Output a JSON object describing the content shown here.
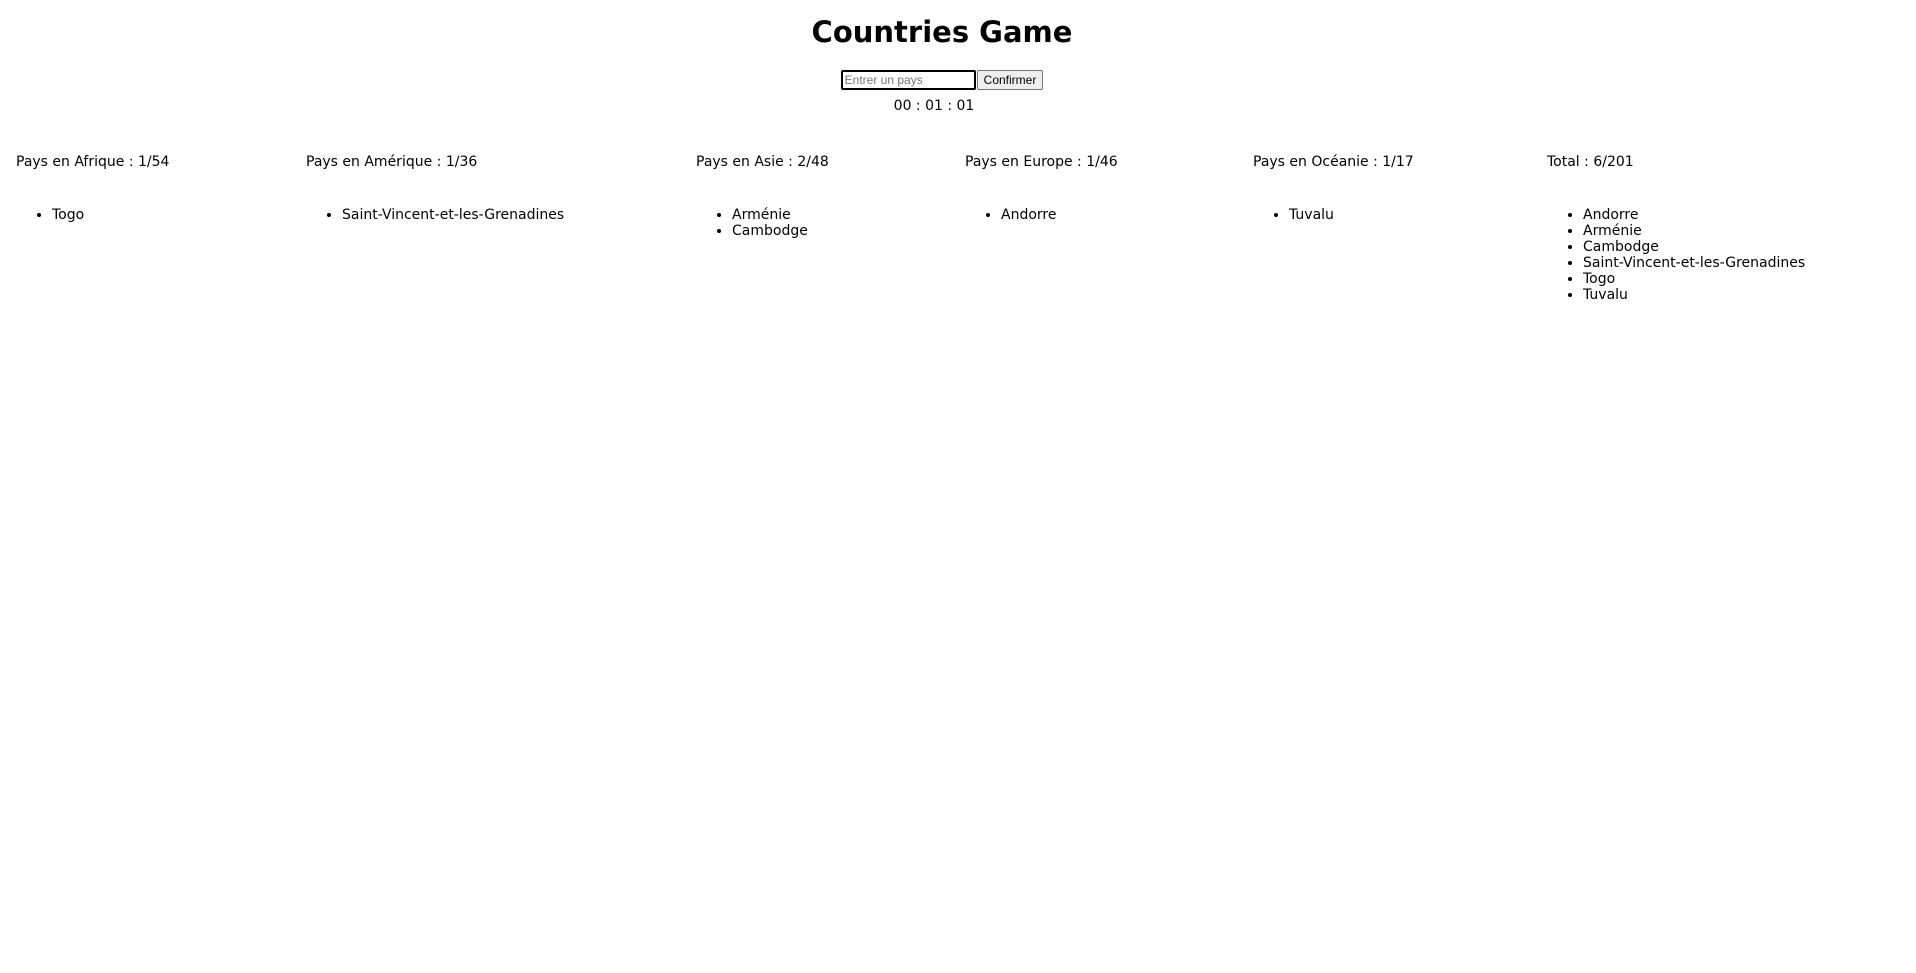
{
  "header": {
    "title": "Countries Game"
  },
  "form": {
    "placeholder": "Entrer un pays",
    "value": "",
    "confirm_label": "Confirmer"
  },
  "timer": {
    "display": "00 : 01 : 01"
  },
  "continents": [
    {
      "heading": "Pays en Afrique : 1/54",
      "countries": [
        "Togo"
      ]
    },
    {
      "heading": "Pays en Amérique : 1/36",
      "countries": [
        "Saint-Vincent-et-les-Grenadines"
      ]
    },
    {
      "heading": "Pays en Asie : 2/48",
      "countries": [
        "Arménie",
        "Cambodge"
      ]
    },
    {
      "heading": "Pays en Europe : 1/46",
      "countries": [
        "Andorre"
      ]
    },
    {
      "heading": "Pays en Océanie : 1/17",
      "countries": [
        "Tuvalu"
      ]
    }
  ],
  "total": {
    "heading": "Total : 6/201",
    "countries": [
      "Andorre",
      "Arménie",
      "Cambodge",
      "Saint-Vincent-et-les-Grenadines",
      "Togo",
      "Tuvalu"
    ]
  }
}
